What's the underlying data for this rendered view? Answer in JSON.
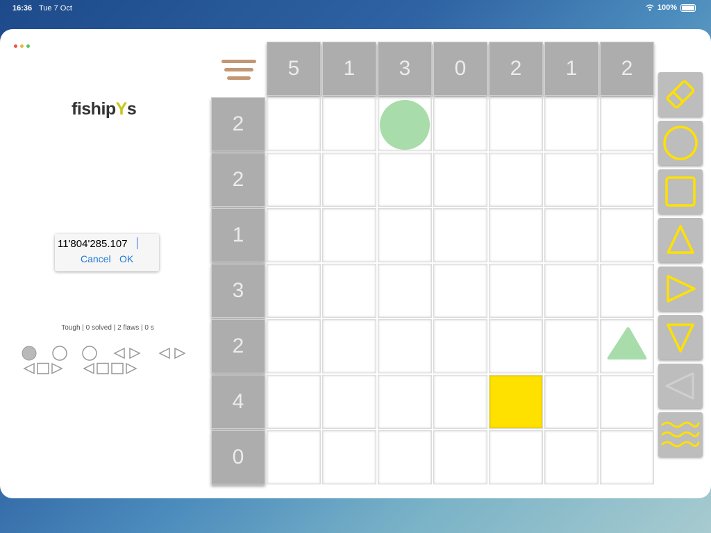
{
  "status_bar": {
    "time": "16:36",
    "date": "Tue 7 Oct",
    "battery": "100%"
  },
  "app": {
    "logo_main": "fiship",
    "logo_y": "Y",
    "logo_end": "s"
  },
  "dialog": {
    "value": "11'804'285.107",
    "cancel_label": "Cancel",
    "ok_label": "OK"
  },
  "stats": "Tough | 0 solved | 2 flaws | 0 s",
  "colors": {
    "clue_bg": "#adadad",
    "cell_fill": "#ffe100",
    "tool_yellow": "#ffe100",
    "green": "#a8dcaa",
    "hamburger": "#c39674"
  },
  "board": {
    "column_clues": [
      "5",
      "1",
      "3",
      "0",
      "2",
      "1",
      "2"
    ],
    "row_clues": [
      "2",
      "2",
      "1",
      "3",
      "2",
      "4",
      "0"
    ],
    "filled_cells": [
      {
        "row": 5,
        "col": 4
      }
    ],
    "marks": [
      {
        "row": 0,
        "col": 2,
        "shape": "circle",
        "color": "green"
      },
      {
        "row": 4,
        "col": 6,
        "shape": "triangle-up",
        "color": "green"
      }
    ]
  },
  "toolbar": {
    "tools": [
      "eraser-icon",
      "circle-icon",
      "square-icon",
      "triangle-up-icon",
      "triangle-right-icon",
      "triangle-down-icon",
      "triangle-left-icon",
      "water-icon"
    ]
  }
}
